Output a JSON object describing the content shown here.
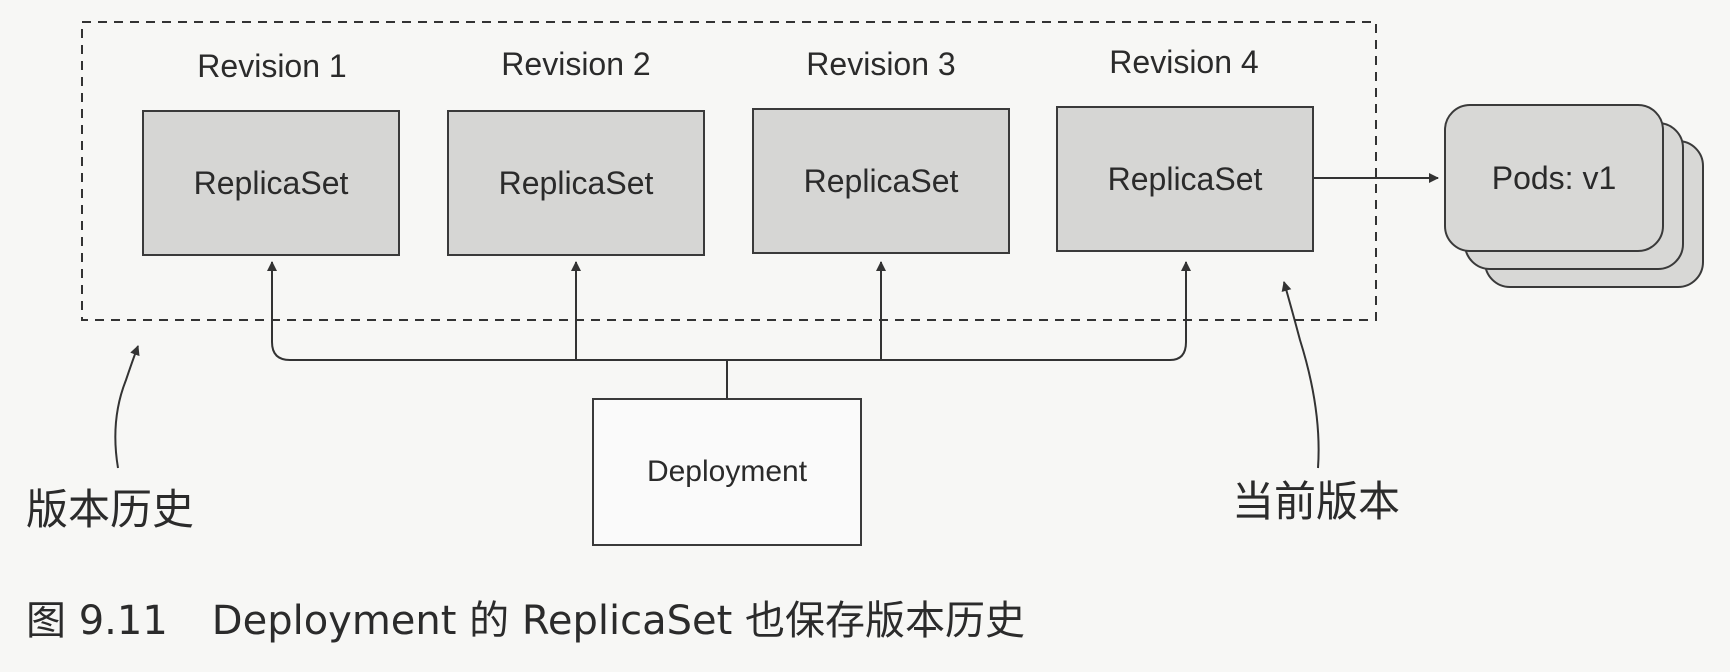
{
  "revisions": [
    {
      "label": "Revision 1",
      "box": "ReplicaSet"
    },
    {
      "label": "Revision 2",
      "box": "ReplicaSet"
    },
    {
      "label": "Revision 3",
      "box": "ReplicaSet"
    },
    {
      "label": "Revision 4",
      "box": "ReplicaSet"
    }
  ],
  "pods_label": "Pods: v1",
  "deployment_label": "Deployment",
  "history_label": "版本历史",
  "current_label": "当前版本",
  "caption": {
    "number": "图 9.11",
    "text": "Deployment 的 ReplicaSet 也保存版本历史"
  }
}
